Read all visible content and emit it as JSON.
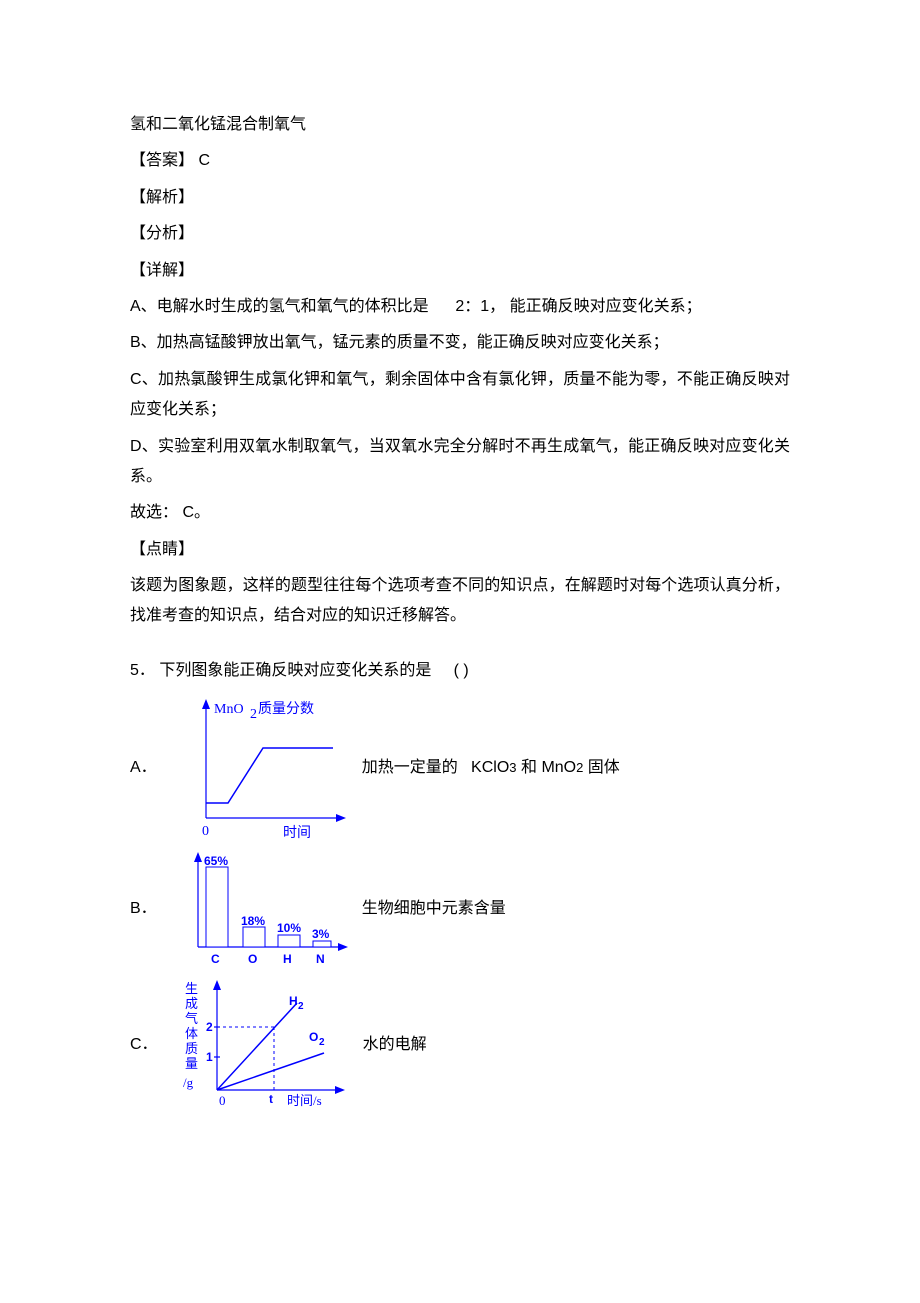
{
  "intro_cont": "氢和二氧化锰混合制氧气",
  "answer_label": "【答案】",
  "answer_text": "C",
  "analysis_label": "【解析】",
  "fenxi_label": "【分析】",
  "detail_label": "【详解】",
  "opt_a": "A、电解水时生成的氢气和氧气的体积比是",
  "opt_a_ratio": "2：1，",
  "opt_a_tail": "能正确反映对应变化关系；",
  "opt_b": "B、加热高锰酸钾放出氧气，锰元素的质量不变，能正确反映对应变化关系；",
  "opt_c": "C、加热氯酸钾生成氯化钾和氧气，剩余固体中含有氯化钾，质量不能为零，不能正确反映对应变化关系；",
  "opt_d": "D、实验室利用双氧水制取氧气，当双氧水完全分解时不再生成氧气，能正确反映对应变化关系。",
  "choose": "故选：",
  "choose_val": "C。",
  "dianjing_label": "【点睛】",
  "dianjing_text": "该题为图象题，这样的题型往往每个选项考查不同的知识点，在解题时对每个选项认真分析，找准考查的知识点，结合对应的知识迁移解答。",
  "q5": {
    "num": "5．",
    "stem": "下列图象能正确反映对应变化关系的是",
    "paren": "( )",
    "a": {
      "letter": "A．",
      "text_pre": "加热一定量的",
      "kclo3": "KClO",
      "kclo3_sub": "3",
      "and": "和",
      "mno2": "MnO",
      "mno2_sub": "2",
      "solid": "固体"
    },
    "b": {
      "letter": "B．",
      "text": "生物细胞中元素含量"
    },
    "c": {
      "letter": "C．",
      "text": "水的电解"
    }
  },
  "chart_data": [
    {
      "type": "line",
      "title": "MnO2质量分数",
      "xlabel": "时间",
      "ylabel": "MnO2质量分数",
      "description": "线从原点开始，先上升再趋于水平",
      "x": [
        0,
        1,
        2,
        4
      ],
      "values": [
        0.1,
        0.18,
        0.25,
        0.25
      ]
    },
    {
      "type": "bar",
      "title": "生物细胞中元素含量",
      "categories": [
        "C",
        "O",
        "H",
        "N"
      ],
      "values": [
        65,
        18,
        10,
        3
      ],
      "labels": [
        "65%",
        "18%",
        "10%",
        "3%"
      ]
    },
    {
      "type": "line",
      "title": "水的电解",
      "xlabel": "时间/s",
      "ylabel": "生成气体质量/g",
      "series": [
        {
          "name": "H2",
          "x": [
            0,
            1
          ],
          "values": [
            0,
            2
          ]
        },
        {
          "name": "O2",
          "x": [
            0,
            1
          ],
          "values": [
            0,
            1
          ]
        }
      ],
      "y_ticks": [
        1,
        2
      ],
      "x_ticks": [
        "t"
      ]
    }
  ]
}
